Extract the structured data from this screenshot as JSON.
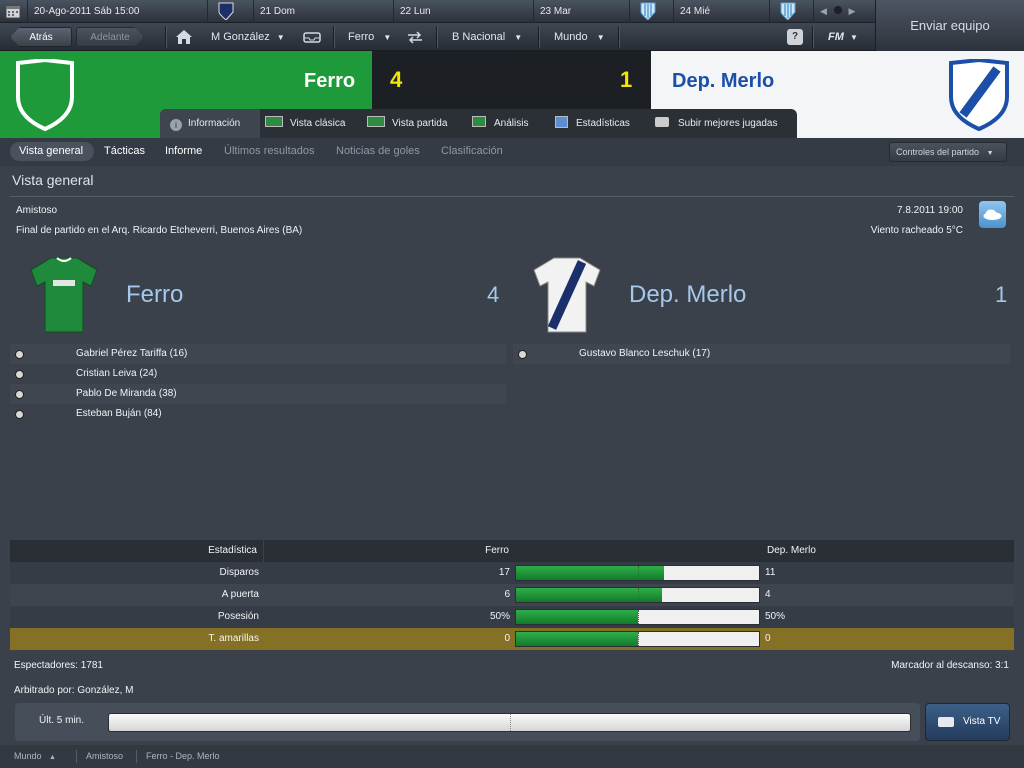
{
  "calendar": {
    "date": "20-Ago-2011",
    "weekday": "Sáb",
    "time": "15:00",
    "days": [
      {
        "label": "21 Dom"
      },
      {
        "label": "22 Lun"
      },
      {
        "label": "23 Mar"
      },
      {
        "label": "24 Mié"
      }
    ]
  },
  "nav": {
    "back": "Atrás",
    "forward": "Adelante",
    "manager": "M González",
    "club": "Ferro",
    "division": "B Nacional",
    "world": "Mundo",
    "help": "?",
    "fm": "FM"
  },
  "send_team": "Enviar equipo",
  "match": {
    "home_team": "Ferro",
    "away_team": "Dep. Merlo",
    "home_score": "4",
    "away_score": "1"
  },
  "tabs": [
    {
      "label": "Información"
    },
    {
      "label": "Vista clásica"
    },
    {
      "label": "Vista partida"
    },
    {
      "label": "Análisis"
    },
    {
      "label": "Estadísticas"
    },
    {
      "label": "Subir mejores jugadas"
    }
  ],
  "subtabs": [
    {
      "label": "Vista general"
    },
    {
      "label": "Tácticas"
    },
    {
      "label": "Informe"
    },
    {
      "label": "Últimos resultados"
    },
    {
      "label": "Noticias de goles"
    },
    {
      "label": "Clasificación"
    }
  ],
  "match_controls": "Controles del partido",
  "overview": {
    "title": "Vista general",
    "competition": "Amistoso",
    "venue": "Final de partido en el Arq. Ricardo Etcheverri, Buenos Aires (BA)",
    "datetime": "7.8.2011 19:00",
    "weather": "Viento racheado 5°C"
  },
  "home_scorers": [
    {
      "name": "Gabriel Pérez Tariffa (16)"
    },
    {
      "name": "Cristian Leiva (24)"
    },
    {
      "name": "Pablo De Miranda (38)"
    },
    {
      "name": "Esteban Buján (84)"
    }
  ],
  "away_scorers": [
    {
      "name": "Gustavo Blanco Leschuk (17)"
    }
  ],
  "stats": {
    "header": {
      "label": "Estadística",
      "home": "Ferro",
      "away": "Dep. Merlo"
    },
    "rows": [
      {
        "label": "Disparos",
        "home": "17",
        "away": "11",
        "home_share": 0.607
      },
      {
        "label": "A puerta",
        "home": "6",
        "away": "4",
        "home_share": 0.6
      },
      {
        "label": "Posesión",
        "home": "50%",
        "away": "50%",
        "home_share": 0.5
      },
      {
        "label": "T. amarillas",
        "home": "0",
        "away": "0",
        "home_share": 0.5
      }
    ]
  },
  "attendance": "Espectadores: 1781",
  "halftime": "Marcador al descanso: 3:1",
  "referee": "Arbitrado por: González, M",
  "timeline_label": "Últ. 5 min.",
  "tv_button": "Vista TV",
  "footer": {
    "world": "Mundo",
    "competition": "Amistoso",
    "fixture": "Ferro - Dep. Merlo"
  },
  "colors": {
    "home_green": "#1f9a3a",
    "score_yellow": "#f5e600",
    "away_blue": "#1b4fa8"
  }
}
